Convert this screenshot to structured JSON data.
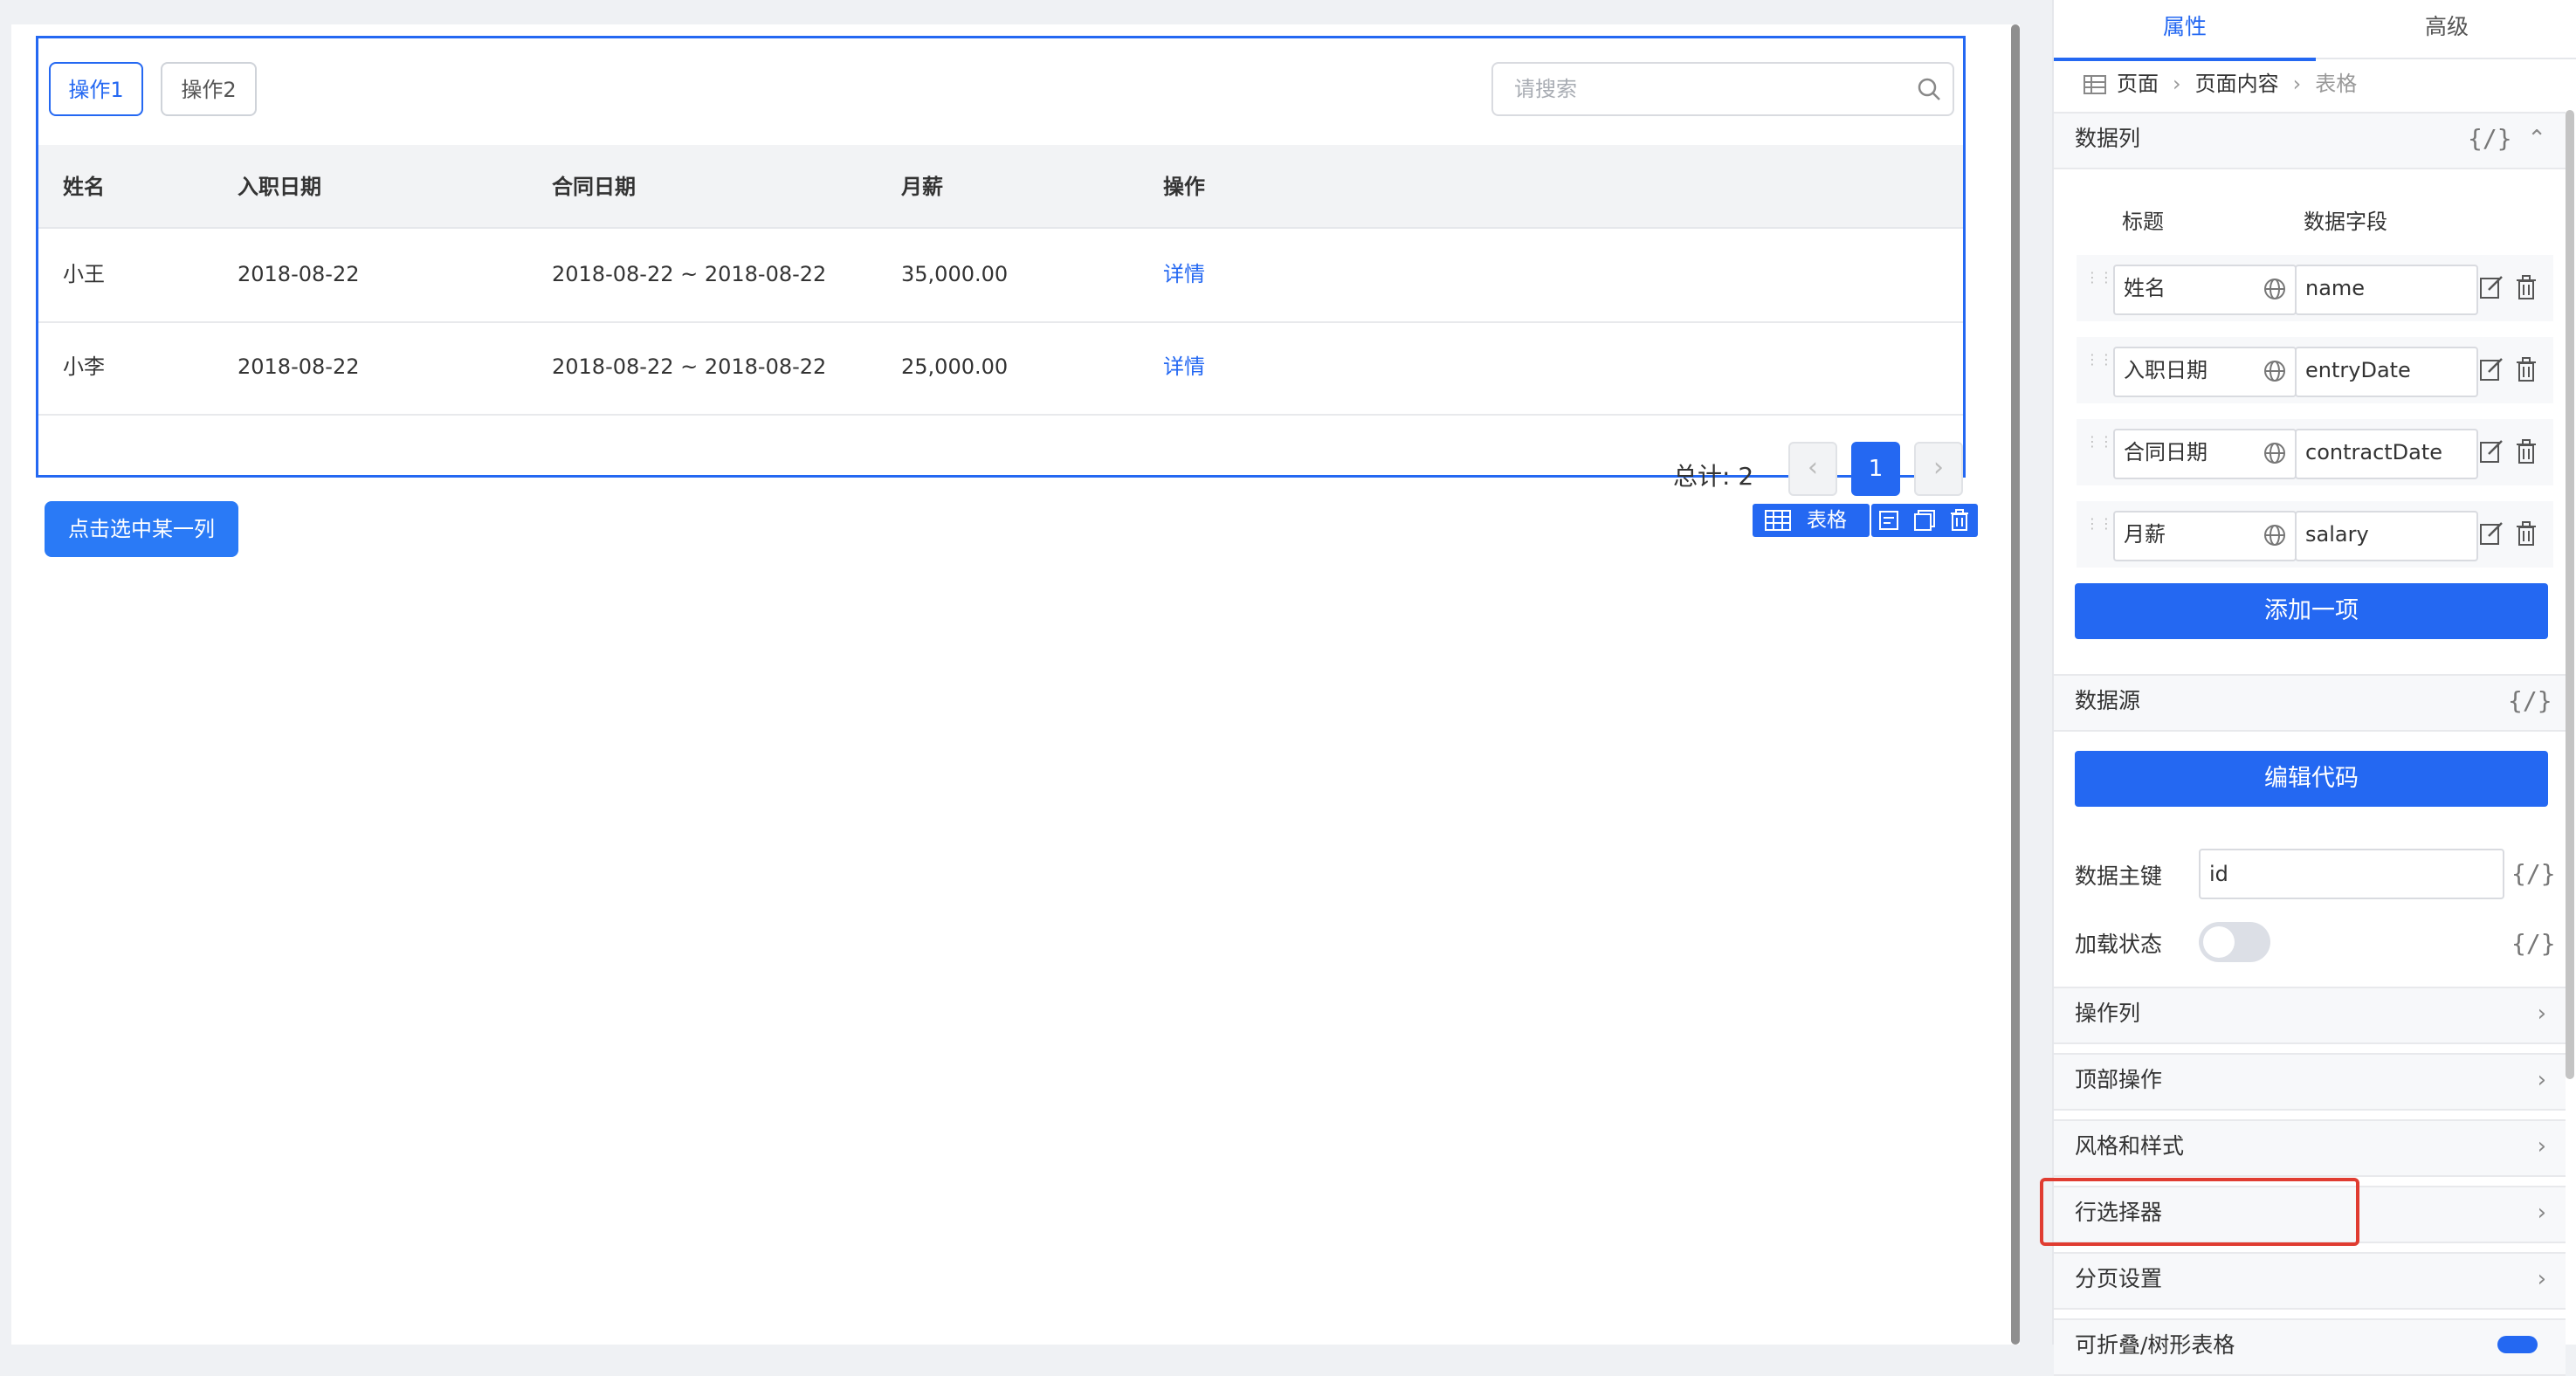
{
  "table": {
    "top_actions": [
      "操作1",
      "操作2"
    ],
    "search_placeholder": "请搜索",
    "columns": [
      "姓名",
      "入职日期",
      "合同日期",
      "月薪",
      "操作"
    ],
    "rows": [
      [
        "小王",
        "2018-08-22",
        "2018-08-22 ~ 2018-08-22",
        "35,000.00",
        "详情"
      ],
      [
        "小李",
        "2018-08-22",
        "2018-08-22 ~ 2018-08-22",
        "25,000.00",
        "详情"
      ]
    ],
    "total_label": "总计: 2",
    "pager": {
      "prev": "‹",
      "current": "1",
      "next": "›"
    }
  },
  "canvas": {
    "select_column_button": "点击选中某一列",
    "component_tag": "表格"
  },
  "panel": {
    "tabs": [
      "属性",
      "高级"
    ],
    "breadcrumb": [
      "页面",
      "页面内容",
      "表格"
    ],
    "sections": {
      "columns": {
        "title": "数据列",
        "fx": "{/}",
        "header_title": "标题",
        "header_field": "数据字段",
        "items": [
          {
            "title": "姓名",
            "field": "name"
          },
          {
            "title": "入职日期",
            "field": "entryDate"
          },
          {
            "title": "合同日期",
            "field": "contractDate"
          },
          {
            "title": "月薪",
            "field": "salary"
          }
        ],
        "add_button": "添加一项"
      },
      "datasource": {
        "title": "数据源",
        "fx": "{/}",
        "edit_code_button": "编辑代码",
        "primary_key_label": "数据主键",
        "primary_key_value": "id",
        "loading_label": "加载状态",
        "loading_on": false
      },
      "collapsed": [
        "操作列",
        "顶部操作",
        "风格和样式",
        "行选择器",
        "分页设置",
        "可折叠/树形表格"
      ]
    }
  },
  "colors": {
    "accent": "#2468f2",
    "highlight": "#e03c31"
  }
}
